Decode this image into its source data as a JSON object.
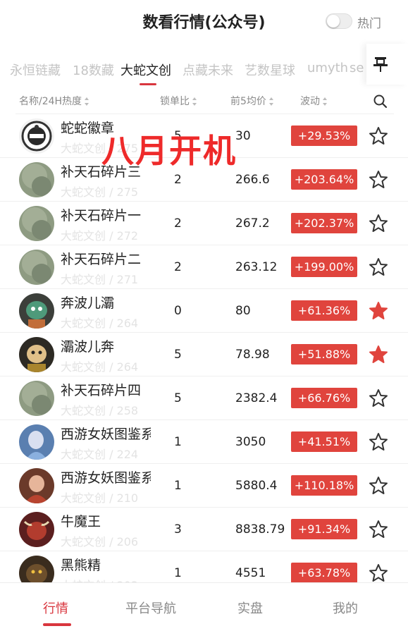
{
  "header": {
    "title": "数看行情(公众号)",
    "hot_label": "热门"
  },
  "platforms": [
    "永恒链藏",
    "18数藏",
    "大蛇文创",
    "点藏未来",
    "艺数星球",
    "umyth",
    "se"
  ],
  "active_platform": "大蛇文创",
  "columns": {
    "name": "名称/24H热度",
    "lock": "锁单比",
    "avg": "前5均价",
    "change": "波动"
  },
  "overlay_text": "八月开机",
  "rows": [
    {
      "name": "蛇蛇徽章",
      "sub": "大蛇文创 / 275",
      "lock": "5",
      "price": "30",
      "change": "+29.53%",
      "fav": false,
      "avatar": "badge"
    },
    {
      "name": "补天石碎片三",
      "sub": "大蛇文创 / 275",
      "lock": "2",
      "price": "266.6",
      "change": "+203.64%",
      "fav": false,
      "avatar": "stone"
    },
    {
      "name": "补天石碎片一",
      "sub": "大蛇文创 / 272",
      "lock": "2",
      "price": "267.2",
      "change": "+202.37%",
      "fav": false,
      "avatar": "stone"
    },
    {
      "name": "补天石碎片二",
      "sub": "大蛇文创 / 271",
      "lock": "2",
      "price": "263.12",
      "change": "+199.00%",
      "fav": false,
      "avatar": "stone"
    },
    {
      "name": "奔波儿灞",
      "sub": "大蛇文创 / 264",
      "lock": "0",
      "price": "80",
      "change": "+61.36%",
      "fav": true,
      "avatar": "monster-green"
    },
    {
      "name": "灞波儿奔",
      "sub": "大蛇文创 / 264",
      "lock": "5",
      "price": "78.98",
      "change": "+51.88%",
      "fav": true,
      "avatar": "monster-dark"
    },
    {
      "name": "补天石碎片四",
      "sub": "大蛇文创 / 258",
      "lock": "5",
      "price": "2382.4",
      "change": "+66.76%",
      "fav": false,
      "avatar": "stone"
    },
    {
      "name": "西游女妖图鉴系",
      "sub": "大蛇文创 / 224",
      "lock": "1",
      "price": "3050",
      "change": "+41.51%",
      "fav": false,
      "avatar": "demoness-blue"
    },
    {
      "name": "西游女妖图鉴系",
      "sub": "大蛇文创 / 210",
      "lock": "1",
      "price": "5880.4",
      "change": "+110.18%",
      "fav": false,
      "avatar": "demoness-red"
    },
    {
      "name": "牛魔王",
      "sub": "大蛇文创 / 206",
      "lock": "3",
      "price": "8838.79",
      "change": "+91.34%",
      "fav": false,
      "avatar": "bull"
    },
    {
      "name": "黑熊精",
      "sub": "大蛇文创 / 203",
      "lock": "1",
      "price": "4551",
      "change": "+63.78%",
      "fav": false,
      "avatar": "bear"
    }
  ],
  "nav": [
    "行情",
    "平台导航",
    "实盘",
    "我的"
  ],
  "colors": {
    "accent": "#d9363e",
    "change_bg": "#e0443d",
    "overlay": "#ee2a2a"
  }
}
